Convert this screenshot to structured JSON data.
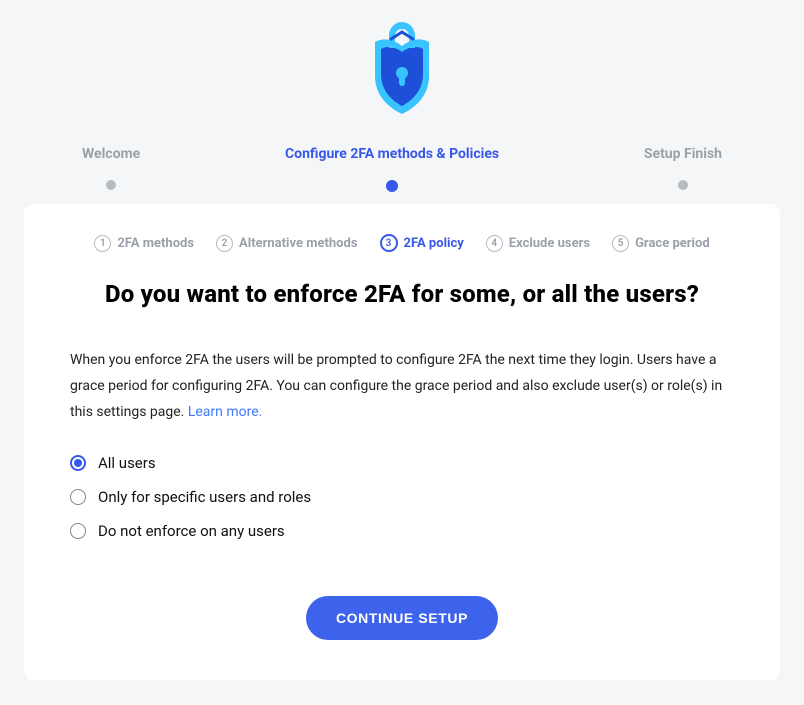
{
  "stepper": [
    {
      "label": "Welcome",
      "active": false
    },
    {
      "label": "Configure 2FA methods & Policies",
      "active": true
    },
    {
      "label": "Setup Finish",
      "active": false
    }
  ],
  "substeps": [
    {
      "num": "1",
      "label": "2FA methods",
      "active": false
    },
    {
      "num": "2",
      "label": "Alternative methods",
      "active": false
    },
    {
      "num": "3",
      "label": "2FA policy",
      "active": true
    },
    {
      "num": "4",
      "label": "Exclude users",
      "active": false
    },
    {
      "num": "5",
      "label": "Grace period",
      "active": false
    }
  ],
  "heading": "Do you want to enforce 2FA for some, or all the users?",
  "desc_text": "When you enforce 2FA the users will be prompted to configure 2FA the next time they login. Users have a grace period for configuring 2FA. You can configure the grace period and also exclude user(s) or role(s) in this settings page. ",
  "learn_more": "Learn more.",
  "options": [
    {
      "label": "All users",
      "checked": true
    },
    {
      "label": "Only for specific users and roles",
      "checked": false
    },
    {
      "label": "Do not enforce on any users",
      "checked": false
    }
  ],
  "button": "CONTINUE SETUP"
}
